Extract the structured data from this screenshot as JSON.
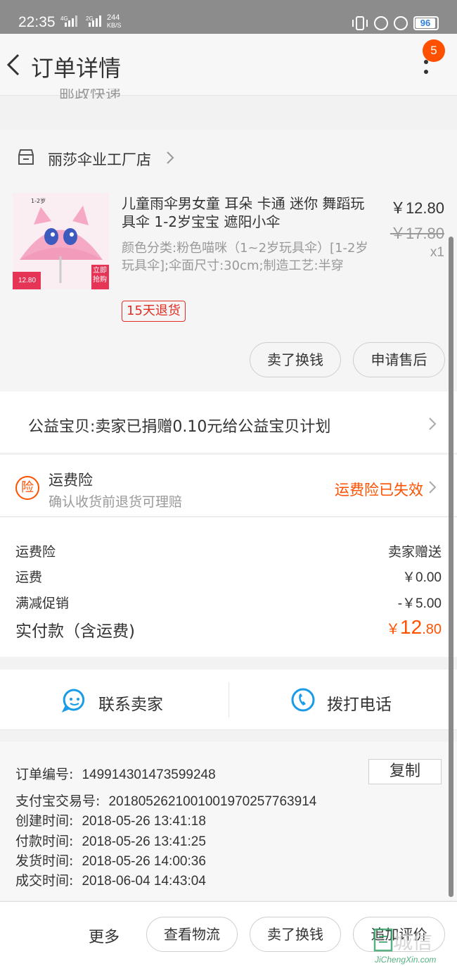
{
  "status_bar": {
    "time": "22:35",
    "net_type_1": "4G",
    "net_type_2": "2G",
    "speed_value": "244",
    "speed_unit": "KB/S",
    "battery": "96"
  },
  "nav": {
    "title": "订单详情",
    "badge_count": "5"
  },
  "cut_text": "邮政快递",
  "shop": {
    "name": "丽莎伞业工厂店"
  },
  "item": {
    "title": "儿童雨伞男女童 耳朵 卡通 迷你 舞蹈玩具伞 1-2岁宝宝 遮阳小伞",
    "sku": "颜色分类:粉色喵咪（1~2岁玩具伞）[1-2岁玩具伞];伞面尺寸:30cm;制造工艺:半穿",
    "price": "￥12.80",
    "original_price": "￥17.80",
    "quantity": "x1",
    "return_tag": "15天退货",
    "image_text_top": "1-2岁",
    "image_text_promo": "立即\n抢购",
    "image_price": "12.80",
    "sell_button": "卖了换钱",
    "after_sale_button": "申请售后"
  },
  "charity": {
    "text": "公益宝贝:卖家已捐赠0.10元给公益宝贝计划"
  },
  "insurance": {
    "icon_char": "险",
    "title": "运费险",
    "subtitle": "确认收货前退货可理赔",
    "status": "运费险已失效",
    "status_color": "#ff5000"
  },
  "fees": {
    "rows": [
      {
        "label": "运费险",
        "value": "卖家赠送"
      },
      {
        "label": "运费",
        "value": "￥0.00"
      },
      {
        "label": "满减促销",
        "value": "-￥5.00"
      }
    ],
    "total_label": "实付款（含运费)",
    "total_currency": "￥",
    "total_int": "12",
    "total_dec": ".80"
  },
  "contact": {
    "seller": "联系卖家",
    "phone": "拨打电话"
  },
  "order_info": {
    "order_no_label": "订单编号:",
    "order_no": "149914301473599248",
    "copy_button": "复制",
    "alipay_label": "支付宝交易号:",
    "alipay_no": "2018052621001001970257763914",
    "created_label": "创建时间:",
    "created": "2018-05-26 13:41:18",
    "paid_label": "付款时间:",
    "paid": "2018-05-26 13:41:25",
    "shipped_label": "发货时间:",
    "shipped": "2018-05-26 14:00:36",
    "completed_label": "成交时间:",
    "completed": "2018-06-04 14:43:04"
  },
  "bottom_bar": {
    "more": "更多",
    "logistics": "查看物流",
    "sell": "卖了换钱",
    "review": "追加评价"
  },
  "watermark": {
    "main": "城信",
    "sub": "JiChengXin.com"
  }
}
